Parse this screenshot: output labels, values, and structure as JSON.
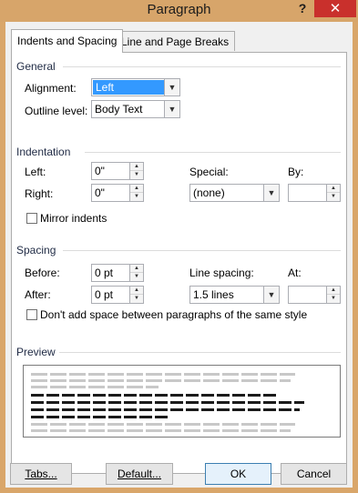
{
  "window": {
    "title": "Paragraph",
    "help": "?",
    "close": "✕"
  },
  "tabs": [
    {
      "label": "Indents and Spacing",
      "active": true
    },
    {
      "label": "Line and Page Breaks",
      "active": false
    }
  ],
  "general": {
    "section": "General",
    "alignment_label": "Alignment:",
    "alignment_value": "Left",
    "outline_label": "Outline level:",
    "outline_value": "Body Text"
  },
  "indentation": {
    "section": "Indentation",
    "left_label": "Left:",
    "left_value": "0\"",
    "right_label": "Right:",
    "right_value": "0\"",
    "special_label": "Special:",
    "special_value": "(none)",
    "by_label": "By:",
    "by_value": "",
    "mirror_label": "Mirror indents"
  },
  "spacing": {
    "section": "Spacing",
    "before_label": "Before:",
    "before_value": "0 pt",
    "after_label": "After:",
    "after_value": "0 pt",
    "line_spacing_label": "Line spacing:",
    "line_spacing_value": "1.5 lines",
    "at_label": "At:",
    "at_value": "",
    "dont_add_label": "Don't add space between paragraphs of the same style"
  },
  "preview": {
    "section": "Preview"
  },
  "buttons": {
    "tabs": "Tabs...",
    "default": "Default...",
    "ok": "OK",
    "cancel": "Cancel"
  },
  "colors": {
    "title_bar": "#d7a56a",
    "close": "#c9302c",
    "selection": "#3399ff"
  }
}
